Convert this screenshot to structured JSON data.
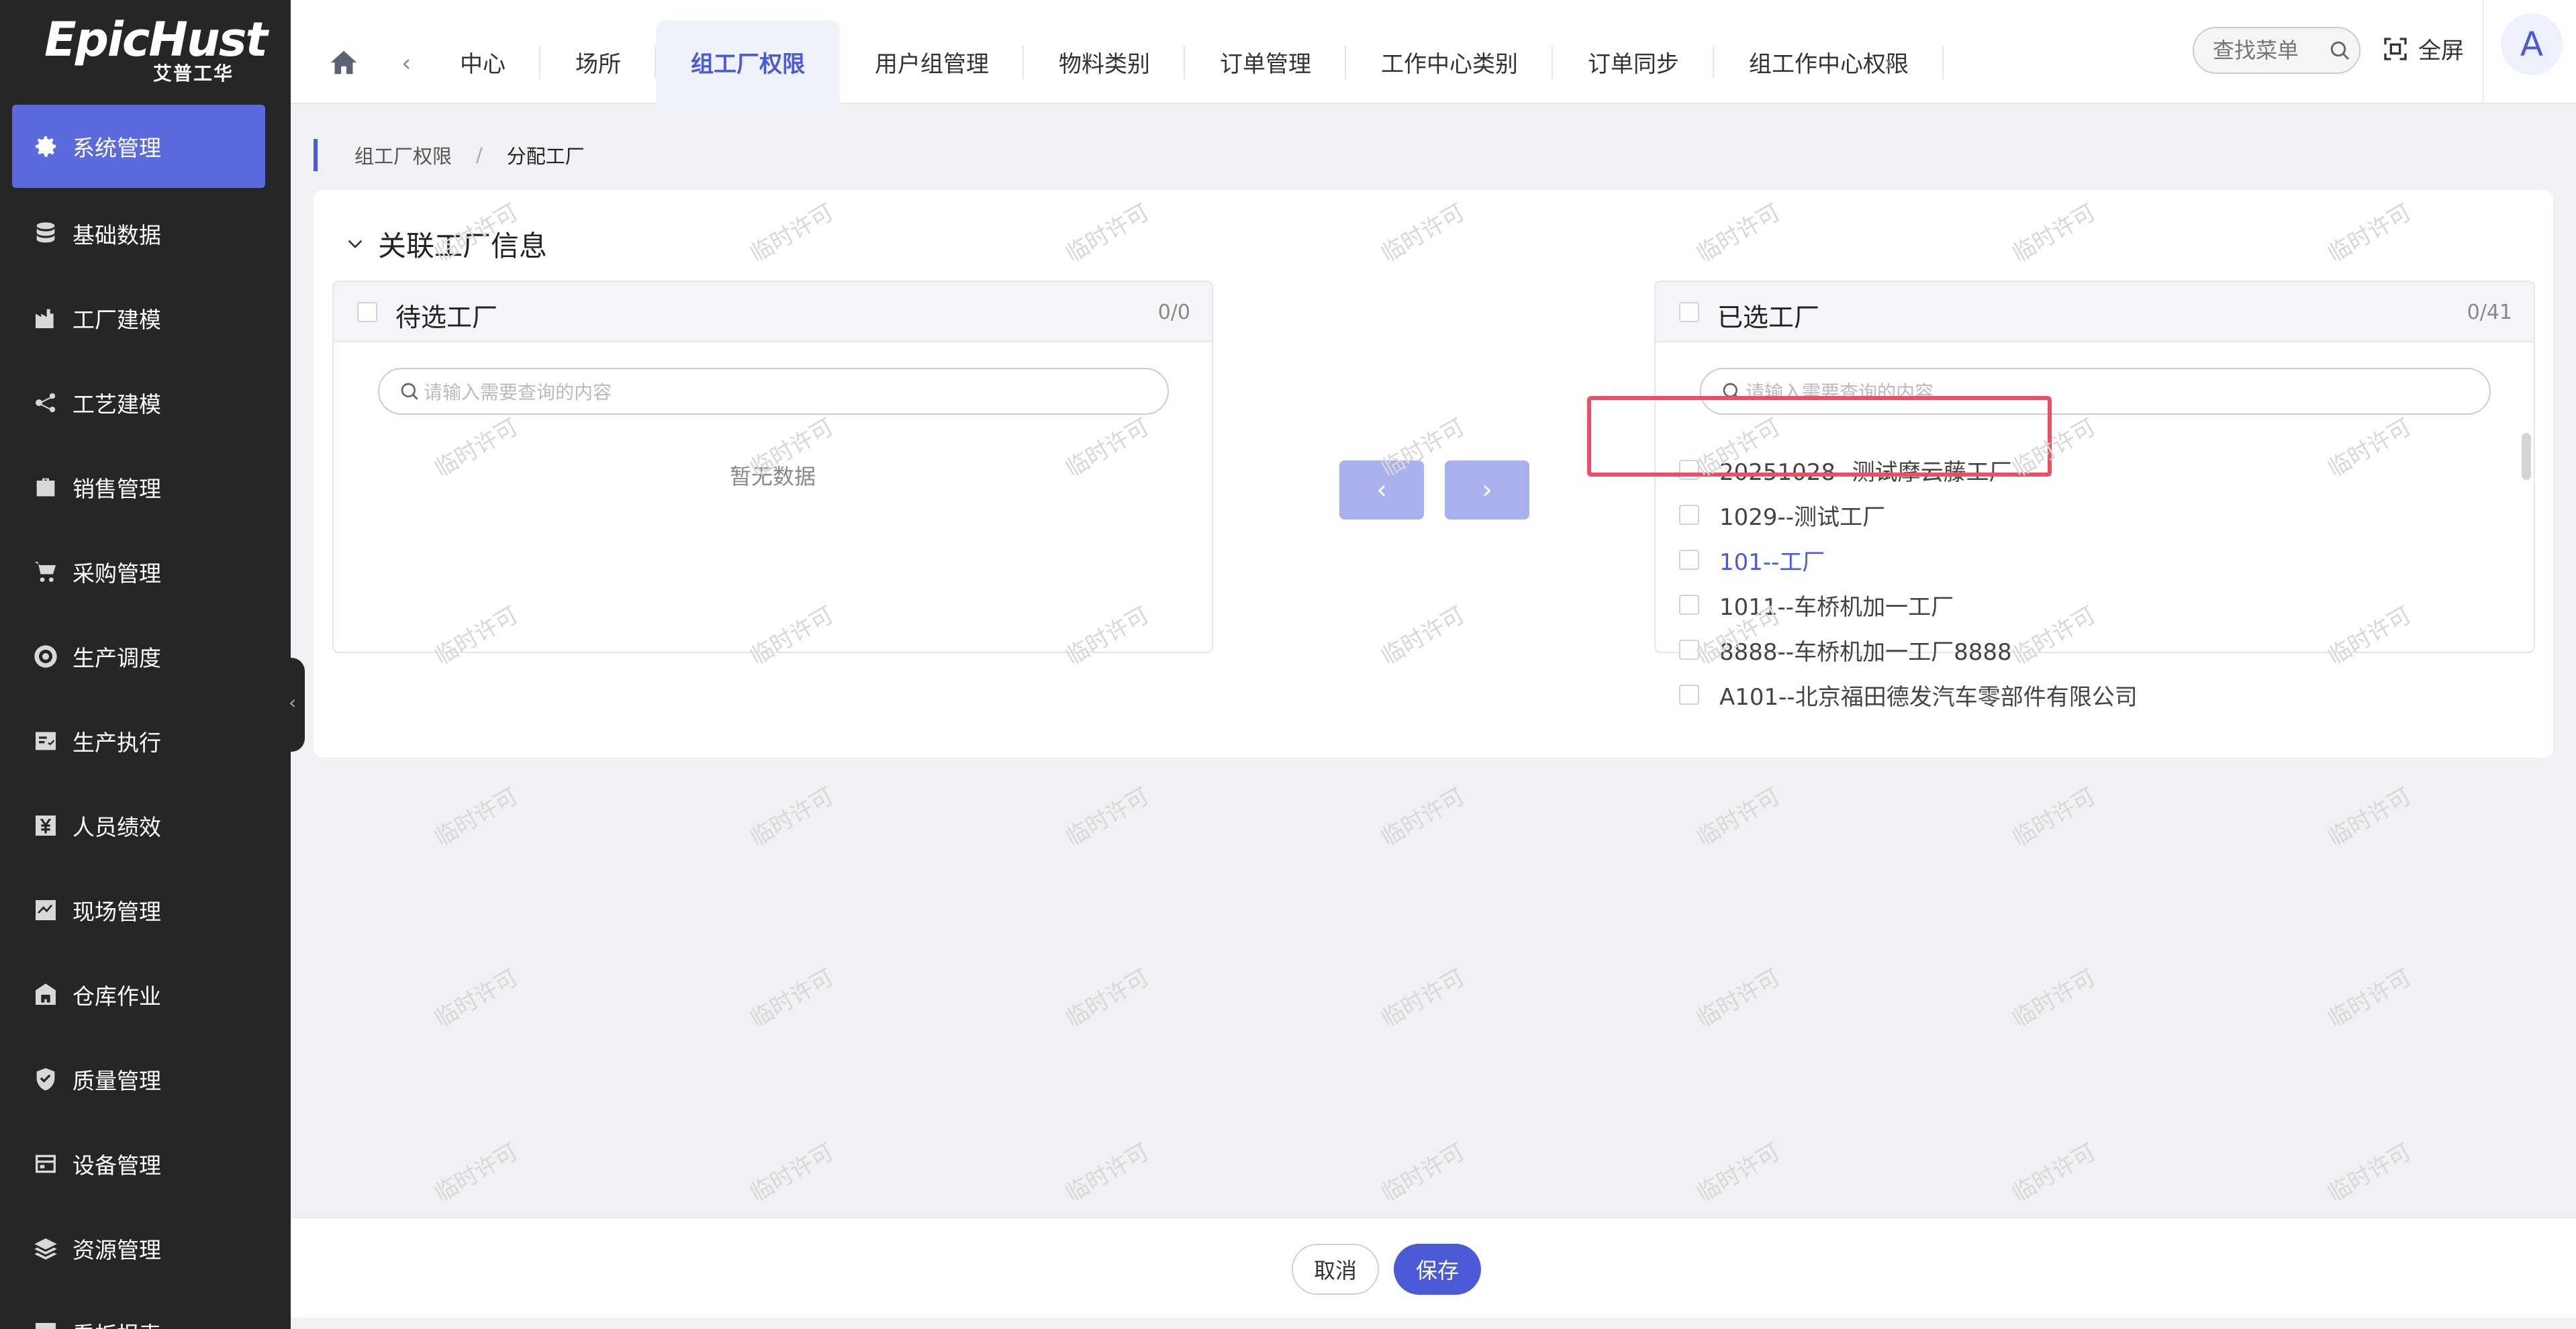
{
  "sidebar": {
    "logo_main": "EpicHust",
    "logo_sub": "艾普工华",
    "items": [
      {
        "label": "系统管理",
        "icon": "gear-icon"
      },
      {
        "label": "基础数据",
        "icon": "database-icon"
      },
      {
        "label": "工厂建模",
        "icon": "factory-icon"
      },
      {
        "label": "工艺建模",
        "icon": "process-icon"
      },
      {
        "label": "销售管理",
        "icon": "briefcase-icon"
      },
      {
        "label": "采购管理",
        "icon": "cart-icon"
      },
      {
        "label": "生产调度",
        "icon": "schedule-icon"
      },
      {
        "label": "生产执行",
        "icon": "execute-icon"
      },
      {
        "label": "人员绩效",
        "icon": "yen-icon"
      },
      {
        "label": "现场管理",
        "icon": "chart-icon"
      },
      {
        "label": "仓库作业",
        "icon": "warehouse-icon"
      },
      {
        "label": "质量管理",
        "icon": "shield-icon"
      },
      {
        "label": "设备管理",
        "icon": "device-icon"
      },
      {
        "label": "资源管理",
        "icon": "layers-icon"
      },
      {
        "label": "看板报表",
        "icon": "board-icon"
      }
    ]
  },
  "topbar": {
    "tabs": [
      "中心",
      "场所",
      "组工厂权限",
      "用户组管理",
      "物料类别",
      "订单管理",
      "工作中心类别",
      "订单同步",
      "组工作中心权限"
    ],
    "active_tab": 2,
    "search_placeholder": "查找菜单",
    "fullscreen_label": "全屏",
    "avatar_letter": "A"
  },
  "breadcrumb": {
    "parent": "组工厂权限",
    "sep": "/",
    "current": "分配工厂"
  },
  "section_title": "关联工厂信息",
  "left_panel": {
    "title": "待选工厂",
    "count": "0/0",
    "search_placeholder": "请输入需要查询的内容",
    "empty_text": "暂无数据"
  },
  "right_panel": {
    "title": "已选工厂",
    "count": "0/41",
    "search_placeholder": "请输入需要查询的内容",
    "items": [
      "20251028--测试摩云藤工厂",
      "1029--测试工厂",
      "101--工厂",
      "1011--车桥机加一工厂",
      "8888--车桥机加一工厂8888",
      "A101--北京福田德发汽车零部件有限公司"
    ]
  },
  "transfer": {
    "left_arrow": "‹",
    "right_arrow": "›"
  },
  "footer": {
    "cancel_label": "取消",
    "save_label": "保存"
  },
  "watermark": "临时许可",
  "colors": {
    "accent": "#4b5bd7",
    "sidebar_bg": "#262626",
    "highlight_box": "#ef4d63"
  }
}
